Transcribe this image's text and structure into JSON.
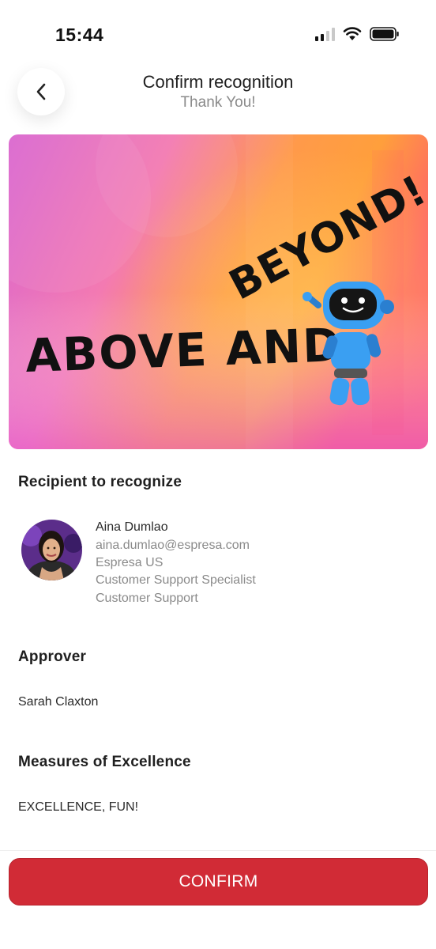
{
  "status_bar": {
    "time": "15:44"
  },
  "header": {
    "title": "Confirm recognition",
    "subtitle": "Thank You!",
    "back_icon": "chevron-left-icon"
  },
  "banner": {
    "text_line1": "ABOVE AND",
    "text_line2": "BEYOND!",
    "colors": {
      "pink": "#e86ac8",
      "orange": "#ffa23a",
      "robot_blue": "#3a9ff2"
    }
  },
  "recipient": {
    "section_title": "Recipient to recognize",
    "name": "Aina Dumlao",
    "email": "aina.dumlao@espresa.com",
    "company": "Espresa US",
    "title": "Customer Support Specialist",
    "department": "Customer Support"
  },
  "approver": {
    "section_title": "Approver",
    "value": "Sarah Claxton"
  },
  "measures": {
    "section_title": "Measures of Excellence",
    "value": "EXCELLENCE, FUN!"
  },
  "footer": {
    "confirm_label": "CONFIRM",
    "accent_color": "#d12b36"
  }
}
